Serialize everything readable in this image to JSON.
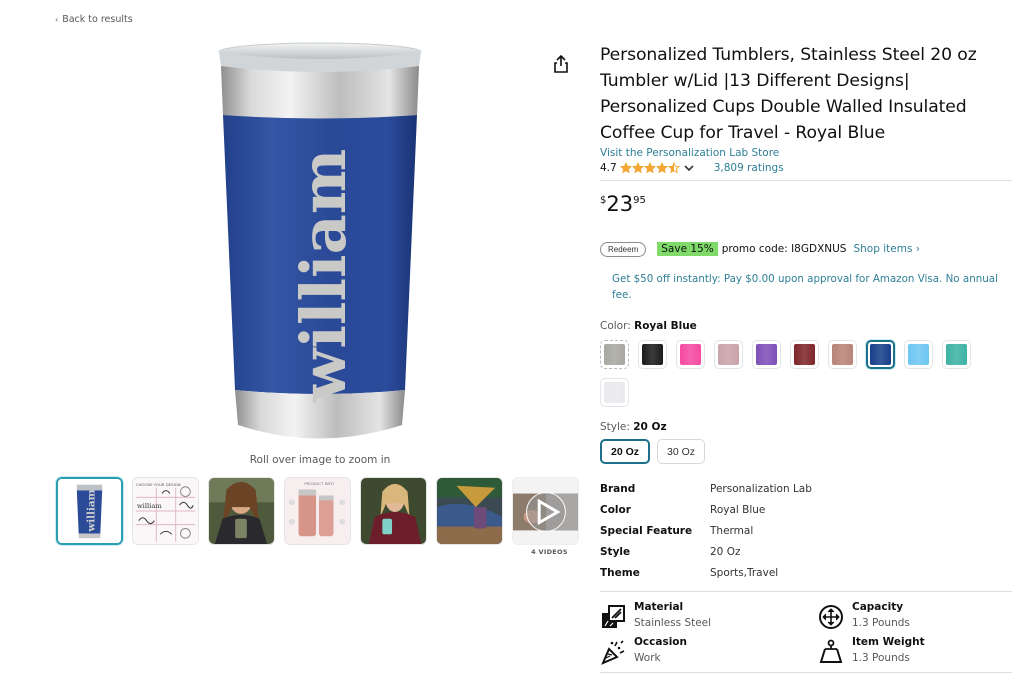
{
  "nav": {
    "back_label": "Back to results"
  },
  "gallery": {
    "engraved_name": "william",
    "zoom_hint": "Roll over image to zoom in",
    "thumbnails": [
      {
        "label": "Royal blue tumbler engraved william"
      },
      {
        "label": "Choose your design"
      },
      {
        "label": "Woman holding olive tumbler"
      },
      {
        "label": "Product info"
      },
      {
        "label": "Woman holding teal tumbler"
      },
      {
        "label": "Purple tumbler on bench"
      },
      {
        "label": "Video"
      }
    ],
    "thumb_text": {
      "choose_design": "CHOOSE YOUR DESIGN",
      "product_info": "PRODUCT INFO",
      "william": "william"
    },
    "videos_label": "4 VIDEOS"
  },
  "product": {
    "title": "Personalized Tumblers, Stainless Steel 20 oz Tumbler w/Lid |13 Different Designs| Personalized Cups Double Walled Insulated Coffee Cup for Travel - Royal Blue",
    "store_link": "Visit the Personalization Lab Store",
    "rating": "4.7",
    "rating_value": 4.7,
    "ratings_count": "3,809 ratings",
    "price": {
      "symbol": "$",
      "whole": "23",
      "fraction": "95"
    },
    "promo": {
      "redeem_label": "Redeem",
      "save_label": "Save 15%",
      "code_text": "promo code: I8GDXNUS",
      "shop_items": "Shop items ›"
    },
    "visa_offer": "Get $50 off instantly: Pay $0.00 upon approval for Amazon Visa. No annual fee.",
    "color": {
      "label": "Color: ",
      "selected": "Royal Blue",
      "swatches": [
        {
          "name": "Gray",
          "color": "#a8a8a0"
        },
        {
          "name": "Black",
          "color": "#1c1c1e"
        },
        {
          "name": "Pink",
          "color": "#f64aa2"
        },
        {
          "name": "Blush",
          "color": "#c9a3a8"
        },
        {
          "name": "Purple",
          "color": "#7e4fb8"
        },
        {
          "name": "Maroon",
          "color": "#7e2629"
        },
        {
          "name": "Rose Gold",
          "color": "#b88478"
        },
        {
          "name": "Royal Blue",
          "color": "#173f8a",
          "selected": true
        },
        {
          "name": "Light Blue",
          "color": "#6ec6f3"
        },
        {
          "name": "Teal",
          "color": "#3db2a3"
        },
        {
          "name": "White",
          "color": "#e9eaee"
        }
      ]
    },
    "style": {
      "label": "Style: ",
      "selected": "20 Oz",
      "options": [
        {
          "label": "20 Oz",
          "selected": true
        },
        {
          "label": "30 Oz",
          "selected": false
        }
      ]
    },
    "specs": [
      {
        "key": "Brand",
        "value": "Personalization Lab"
      },
      {
        "key": "Color",
        "value": "Royal Blue"
      },
      {
        "key": "Special Feature",
        "value": "Thermal"
      },
      {
        "key": "Style",
        "value": "20 Oz"
      },
      {
        "key": "Theme",
        "value": "Sports,Travel"
      }
    ],
    "highlights": [
      {
        "icon": "material-icon",
        "key": "Material",
        "value": "Stainless Steel"
      },
      {
        "icon": "capacity-icon",
        "key": "Capacity",
        "value": "1.3 Pounds"
      },
      {
        "icon": "occasion-icon",
        "key": "Occasion",
        "value": "Work"
      },
      {
        "icon": "weight-icon",
        "key": "Item Weight",
        "value": "1.3 Pounds"
      }
    ]
  },
  "colors": {
    "link": "#2f7f96",
    "star": "#f3a533",
    "save_badge": "#7fda69",
    "selected_border": "#1d7089"
  }
}
